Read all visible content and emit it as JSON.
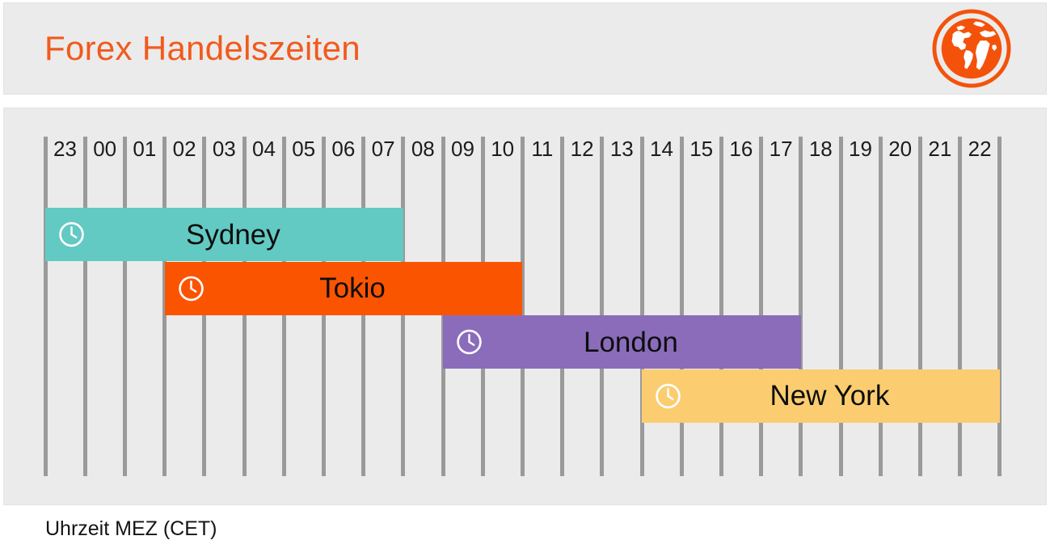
{
  "header": {
    "title": "Forex Handelszeiten",
    "logo_icon": "globe-icon",
    "title_color": "#f15a1d",
    "logo_color": "#f4520b",
    "background": "#ebebeb"
  },
  "chart_data": {
    "type": "bar",
    "title": "Forex Handelszeiten",
    "xlabel": "Uhrzeit MEZ (CET)",
    "ylabel": "",
    "orientation": "horizontal",
    "grid": true,
    "legend": "none",
    "hour_labels": [
      "23",
      "00",
      "01",
      "02",
      "03",
      "04",
      "05",
      "06",
      "07",
      "08",
      "09",
      "10",
      "11",
      "12",
      "13",
      "14",
      "15",
      "16",
      "17",
      "18",
      "19",
      "20",
      "21",
      "22"
    ],
    "x_axis_note": "Hour columns from 23 to 22 (next day), CET",
    "categories": [
      "Sydney",
      "Tokio",
      "London",
      "New York"
    ],
    "series": [
      {
        "name": "Sydney",
        "start_hour": "23",
        "end_hour": "08",
        "start_col": 0,
        "span_cols": 9,
        "color": "#63c9c3",
        "clock_icon": "clock-icon"
      },
      {
        "name": "Tokio",
        "start_hour": "02",
        "end_hour": "11",
        "start_col": 3,
        "span_cols": 9,
        "color": "#fb5400",
        "clock_icon": "clock-icon"
      },
      {
        "name": "London",
        "start_hour": "09",
        "end_hour": "18",
        "start_col": 10,
        "span_cols": 9,
        "color": "#8a6cba",
        "clock_icon": "clock-icon"
      },
      {
        "name": "New York",
        "start_hour": "14",
        "end_hour": "23",
        "start_col": 15,
        "span_cols": 9,
        "color": "#fbcd70",
        "clock_icon": "clock-icon"
      }
    ]
  },
  "footer": {
    "caption": "Uhrzeit MEZ (CET)"
  }
}
